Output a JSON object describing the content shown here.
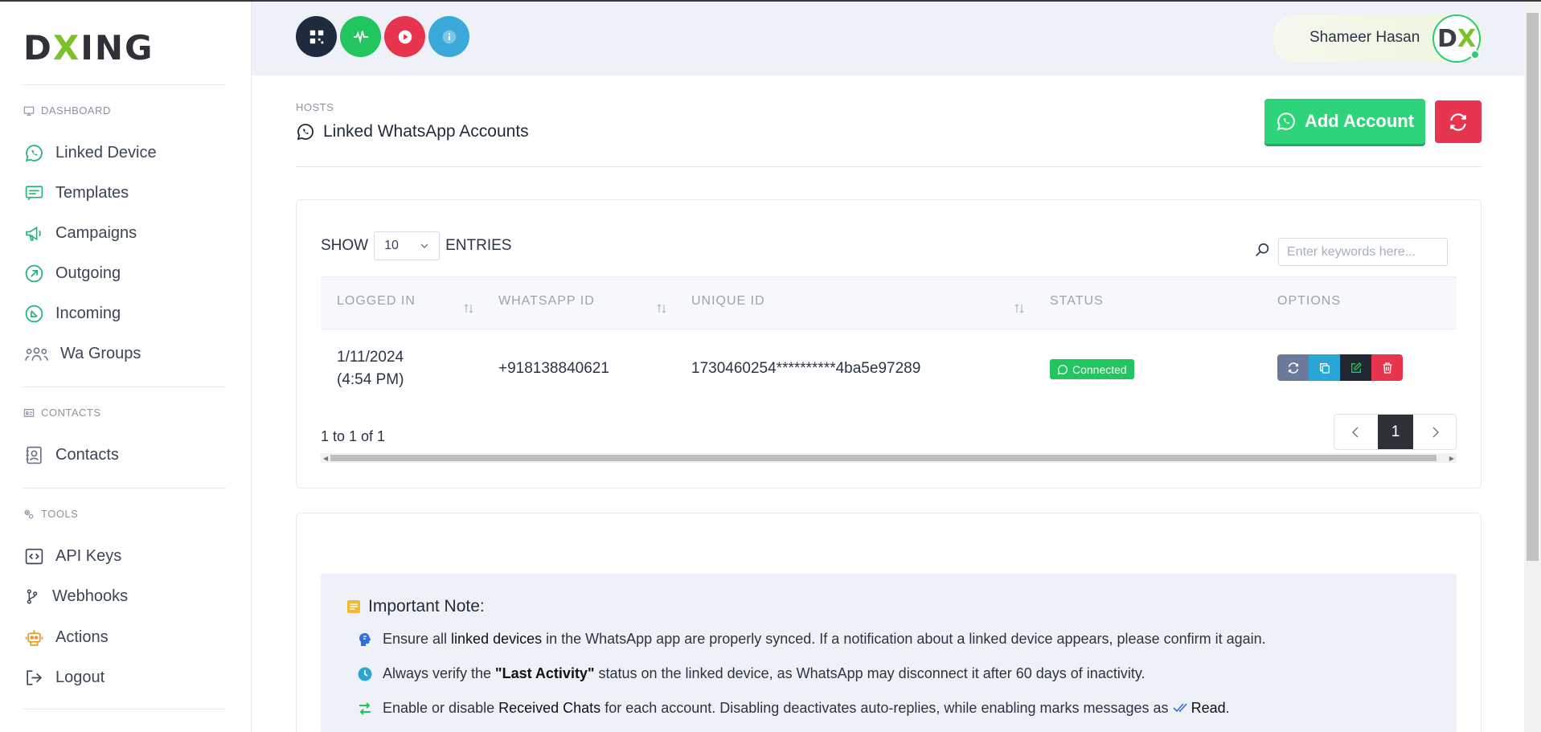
{
  "brand": {
    "logo_pre": "D",
    "logo_x": "X",
    "logo_post": "ING"
  },
  "sidebar": {
    "sections": [
      {
        "label": "DASHBOARD",
        "icon": "monitor-icon"
      },
      {
        "label": "CONTACTS",
        "icon": "id-card-icon"
      },
      {
        "label": "TOOLS",
        "icon": "gears-icon"
      }
    ],
    "items": [
      {
        "label": "Linked Device",
        "icon": "whatsapp-icon"
      },
      {
        "label": "Templates",
        "icon": "template-icon"
      },
      {
        "label": "Campaigns",
        "icon": "megaphone-icon"
      },
      {
        "label": "Outgoing",
        "icon": "outgoing-arrow-icon"
      },
      {
        "label": "Incoming",
        "icon": "incoming-arrow-icon"
      },
      {
        "label": "Wa Groups",
        "icon": "group-icon"
      },
      {
        "label": "Contacts",
        "icon": "contact-icon"
      },
      {
        "label": "API Keys",
        "icon": "code-icon"
      },
      {
        "label": "Webhooks",
        "icon": "branch-icon"
      },
      {
        "label": "Actions",
        "icon": "robot-icon"
      },
      {
        "label": "Logout",
        "icon": "logout-icon"
      }
    ]
  },
  "header": {
    "buttons": [
      {
        "name": "qr-code-icon",
        "color": "#1e2a3d"
      },
      {
        "name": "pulse-icon",
        "color": "#22c55e"
      },
      {
        "name": "play-icon",
        "color": "#e8354f"
      },
      {
        "name": "info-icon",
        "color": "#3aa8d8"
      }
    ],
    "user_name": "Shameer Hasan",
    "avatar_pre": "D",
    "avatar_x": "X"
  },
  "page": {
    "breadcrumb": "HOSTS",
    "title": "Linked WhatsApp Accounts",
    "add_button": "Add Account"
  },
  "table": {
    "show_label": "SHOW",
    "entries_label": "ENTRIES",
    "page_size": "10",
    "search_placeholder": "Enter keywords here...",
    "columns": [
      "LOGGED IN",
      "WHATSAPP ID",
      "UNIQUE ID",
      "STATUS",
      "OPTIONS"
    ],
    "rows": [
      {
        "logged_in_date": "1/11/2024",
        "logged_in_time": "(4:54 PM)",
        "whatsapp_id": "+918138840621",
        "unique_id": "1730460254**********4ba5e97289",
        "status": "Connected"
      }
    ],
    "info": "1 to 1 of 1",
    "current_page": "1"
  },
  "note": {
    "title": "Important Note:",
    "lines": [
      {
        "pre": "Ensure all ",
        "bold": "linked devices",
        "post": " in the WhatsApp app are properly synced. If a notification about a linked device appears, please confirm it again.",
        "icon": "brain-icon"
      },
      {
        "pre": "Always verify the ",
        "bold": "\"Last Activity\"",
        "post": " status on the linked device, as WhatsApp may disconnect it after 60 days of inactivity.",
        "icon": "clock-icon"
      },
      {
        "pre": "Enable or disable ",
        "bold": "Received Chats",
        "post": " for each account. Disabling deactivates auto-replies, while enabling marks messages as ",
        "tail": "Read",
        "icon": "toggle-arrows-icon"
      }
    ]
  },
  "colors": {
    "accent_green": "#2ed47a",
    "danger": "#e8354f",
    "dark": "#2e3238",
    "sidebar_icon": "#22b573"
  }
}
